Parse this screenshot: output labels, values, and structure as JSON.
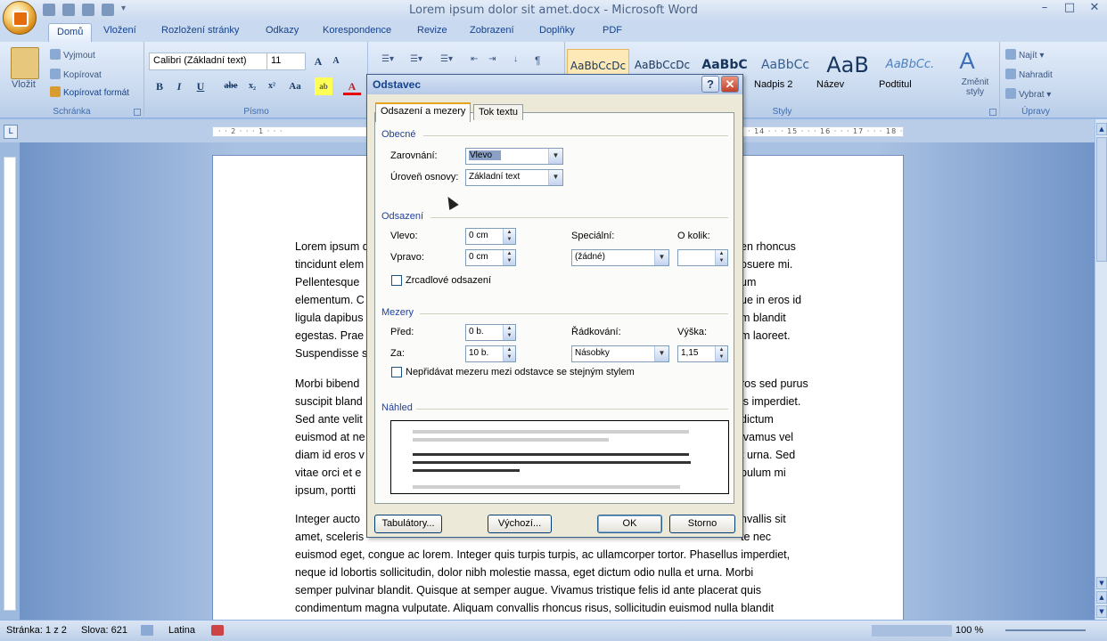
{
  "window": {
    "title": "Lorem ipsum dolor sit amet.docx - Microsoft Word",
    "controls": [
      "–",
      "□",
      "✕"
    ]
  },
  "ribbon_tabs": [
    "Domů",
    "Vložení",
    "Rozložení stránky",
    "Odkazy",
    "Korespondence",
    "Revize",
    "Zobrazení",
    "Doplňky",
    "PDF"
  ],
  "clipboard": {
    "paste": "Vložit",
    "cut": "Vyjmout",
    "copy": "Kopírovat",
    "format_painter": "Kopírovat formát",
    "label": "Schránka"
  },
  "font": {
    "name": "Calibri (Základní text)",
    "size": "11",
    "label": "Písmo",
    "bold": "B",
    "italic": "I",
    "underline": "U",
    "strike": "abe",
    "sub": "x₂",
    "sup": "x²",
    "case": "Aa",
    "grow": "A",
    "shrink": "A"
  },
  "styles": {
    "label": "Styly",
    "items": [
      {
        "preview": "AaBbCcDc",
        "name": ""
      },
      {
        "preview": "AaBbCcDc",
        "name": ""
      },
      {
        "preview": "AaBbC",
        "name": ""
      },
      {
        "preview": "AaBbCc",
        "name": "Nadpis 2"
      },
      {
        "preview": "AaB",
        "name": "Název"
      },
      {
        "preview": "AaBbCc.",
        "name": "Podtitul"
      }
    ],
    "change": "Změnit styly"
  },
  "editing": {
    "label": "Úpravy",
    "find": "Najít",
    "replace": "Nahradit",
    "select": "Vybrat"
  },
  "ruler": {
    "left_ticks": "· · 2 · · · 1 · · ·",
    "right_ticks": "· 14 · · · 15 · · · 16 · · · 17 · · · 18 ·"
  },
  "document": {
    "p1_left": [
      "Lorem ipsum d",
      "tincidunt elem",
      "Pellentesque",
      "elementum. C",
      "ligula dapibus",
      "egestas. Prae",
      "Suspendisse s"
    ],
    "p1_right": [
      "en rhoncus",
      "osuere mi.",
      "um",
      "ue in eros id",
      "m blandit",
      "m laoreet.",
      ""
    ],
    "p2_left": [
      "Morbi bibend",
      "suscipit bland",
      "Sed ante velit",
      "euismod at ne",
      "diam id eros v",
      "vitae orci et e",
      "ipsum, portti"
    ],
    "p2_right": [
      "ros sed purus",
      "is imperdiet.",
      "dictum",
      "ivamus vel",
      "t urna. Sed",
      "bulum mi",
      ""
    ],
    "p3_lines": [
      "Integer aucto",
      "amet, sceleris",
      "euismod eget, congue ac lorem. Integer quis turpis turpis, ac ullamcorper tortor. Phasellus imperdiet,",
      "neque id lobortis sollicitudin, dolor nibh molestie massa, eget dictum odio nulla et urna. Morbi",
      "semper pulvinar blandit. Quisque at semper augue. Vivamus tristique felis id ante placerat quis",
      "condimentum magna vulputate. Aliquam convallis rhoncus risus, sollicitudin euismod nulla blandit"
    ],
    "p3_right": [
      "nvallis sit",
      "te nec"
    ]
  },
  "status_bar": {
    "page": "Stránka: 1 z 2",
    "words": "Slova: 621",
    "language": "Latina",
    "zoom": "100 %"
  },
  "dialog": {
    "title": "Odstavec",
    "help": "?",
    "close": "✕",
    "tabs": [
      "Odsazení a mezery",
      "Tok textu"
    ],
    "general": {
      "heading": "Obecné",
      "alignment_label": "Zarovnání:",
      "alignment_value": "Vlevo",
      "outline_label": "Úroveň osnovy:",
      "outline_value": "Základní text"
    },
    "indent": {
      "heading": "Odsazení",
      "left_label": "Vlevo:",
      "left_value": "0 cm",
      "right_label": "Vpravo:",
      "right_value": "0 cm",
      "special_label": "Speciální:",
      "special_value": "(žádné)",
      "by_label": "O kolik:",
      "by_value": "",
      "mirror_label": "Zrcadlové odsazení"
    },
    "spacing": {
      "heading": "Mezery",
      "before_label": "Před:",
      "before_value": "0 b.",
      "after_label": "Za:",
      "after_value": "10 b.",
      "line_label": "Řádkování:",
      "line_value": "Násobky",
      "at_label": "Výška:",
      "at_value": "1,15",
      "dont_add_label": "Nepřidávat mezeru mezi odstavce se stejným stylem"
    },
    "preview_heading": "Náhled",
    "buttons": {
      "tabs": "Tabulátory...",
      "default": "Výchozí...",
      "ok": "OK",
      "cancel": "Storno"
    }
  }
}
